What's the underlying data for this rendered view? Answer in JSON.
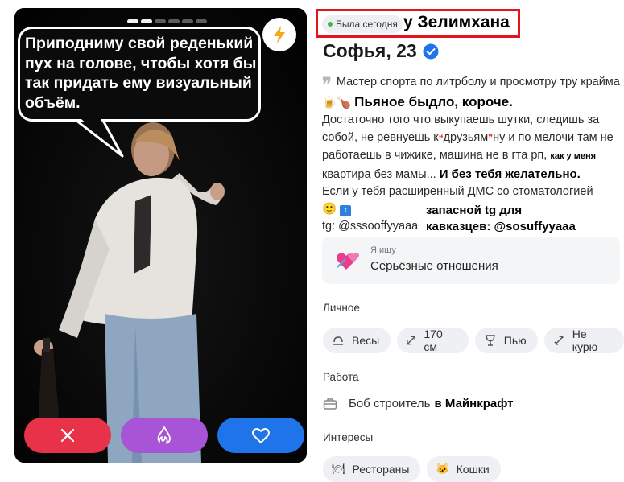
{
  "photo_card": {
    "bubble_text": "Приподниму свой реденький пух на голове, чтобы хотя бы так придать ему визуальный объём.",
    "actions": {
      "pass_icon": "close-icon",
      "superlike_icon": "flame-icon",
      "like_icon": "heart-icon"
    }
  },
  "profile": {
    "online_status": "Была сегодня",
    "annotation_title": "у Зелимхана",
    "name_age": "Софья, 23",
    "bio": {
      "line1": "Мастер спорта по литрболу и просмотру тру крайма",
      "emphasis1": "Пьяное быдло, короче.",
      "line2a": "Достаточно того что выкупаешь шутки, следишь за собой, не ревнуешь к",
      "line2b": "друзьям",
      "line2c": "ну и по мелочи там не работаешь в чижике, машина не в гта рп,",
      "emphasis_small": "как у меня",
      "line3": "квартира без мамы...",
      "emphasis2": "И без тебя желательно.",
      "line4": "Если у тебя расширенный ДМС со стоматологией",
      "tg": "tg: @sssooffyyaaa",
      "tg_extra_line1": "запасной tg для",
      "tg_extra_line2": "кавказцев: @sosuffyyaaa"
    },
    "looking_for": {
      "label": "Я ищу",
      "value": "Серьёзные отношения"
    },
    "personal": {
      "title": "Личное",
      "chips": [
        {
          "icon": "scales-icon",
          "label": "Весы"
        },
        {
          "icon": "height-icon",
          "label": "170 см"
        },
        {
          "icon": "wine-glass-icon",
          "label": "Пью"
        },
        {
          "icon": "no-smoking-icon",
          "label": "Не курю"
        }
      ]
    },
    "work": {
      "title": "Работа",
      "value": "Боб строитель",
      "extra": "в Майнкрафт"
    },
    "interests": {
      "title": "Интересы",
      "chips": [
        {
          "icon": "restaurant-icon",
          "label": "Рестораны"
        },
        {
          "icon": "cat-icon",
          "label": "Кошки"
        }
      ]
    }
  },
  "colors": {
    "pass": "#e8324a",
    "superlike": "#a755d6",
    "like": "#1e74e8",
    "annotation": "#e2151c",
    "verified": "#1e74e8"
  }
}
